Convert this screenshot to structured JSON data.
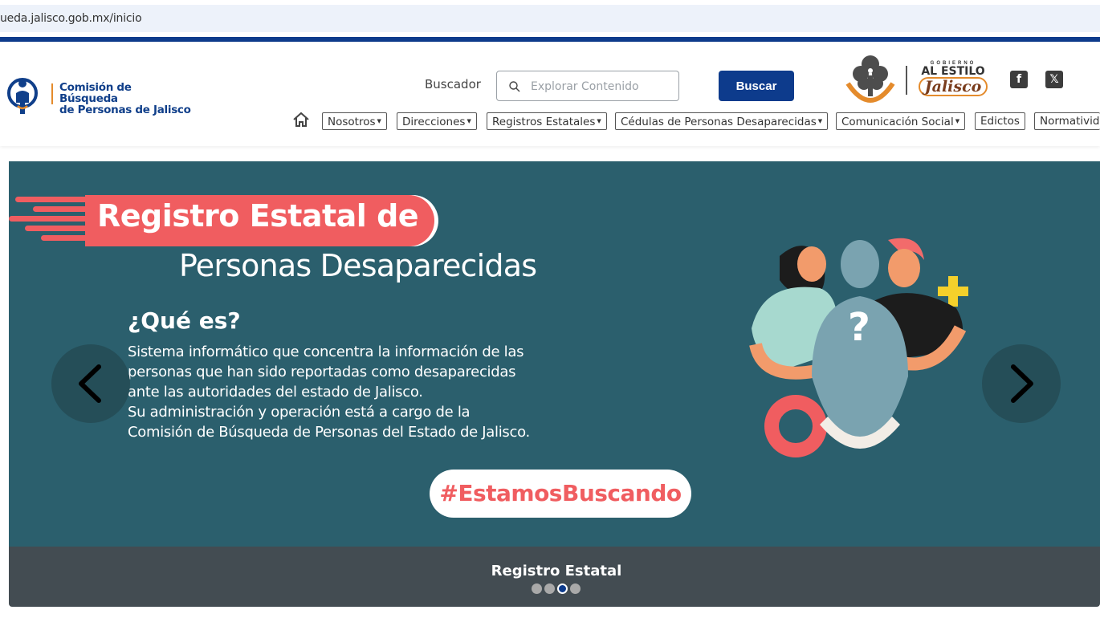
{
  "browser": {
    "url": "ueda.jalisco.gob.mx/inicio"
  },
  "header": {
    "logo_line1": "Comisión de Búsqueda",
    "logo_line2": "de Personas de Jalisco",
    "search_label": "Buscador",
    "search_placeholder": "Explorar Contenido",
    "search_button": "Buscar",
    "gov_logo_small": "GOBIERNO",
    "gov_logo_text": "AL ESTILO",
    "gov_logo_name": "Jalisco",
    "social": [
      {
        "icon": "facebook-icon",
        "glyph": "f"
      },
      {
        "icon": "x-twitter-icon",
        "glyph": "𝕏"
      }
    ]
  },
  "nav": {
    "items": [
      {
        "label": "Nosotros",
        "dropdown": true
      },
      {
        "label": "Direcciones",
        "dropdown": true
      },
      {
        "label": "Registros Estatales",
        "dropdown": true
      },
      {
        "label": "Cédulas de Personas Desaparecidas",
        "dropdown": true
      },
      {
        "label": "Comunicación Social",
        "dropdown": true
      },
      {
        "label": "Edictos",
        "dropdown": false
      },
      {
        "label": "Normatividad",
        "dropdown": false
      }
    ]
  },
  "carousel": {
    "banner_title": "Registro Estatal de",
    "banner_subtitle": "Personas Desaparecidas",
    "question": "¿Qué es?",
    "description": [
      "Sistema informático que concentra la información de las",
      "personas que han sido reportadas como desaparecidas",
      "ante las autoridades del estado de Jalisco.",
      "Su administración y operación está a cargo de la",
      "Comisión de Búsqueda de Personas del Estado de Jalisco."
    ],
    "hashtag": "#EstamosBuscando",
    "caption": "Registro Estatal",
    "slide_count": 4,
    "active_slide": 3
  },
  "colors": {
    "brand_blue": "#0d3b8c",
    "slide_bg": "#2b5f6d",
    "accent_coral": "#f05d60",
    "caption_bg": "#434c52"
  }
}
